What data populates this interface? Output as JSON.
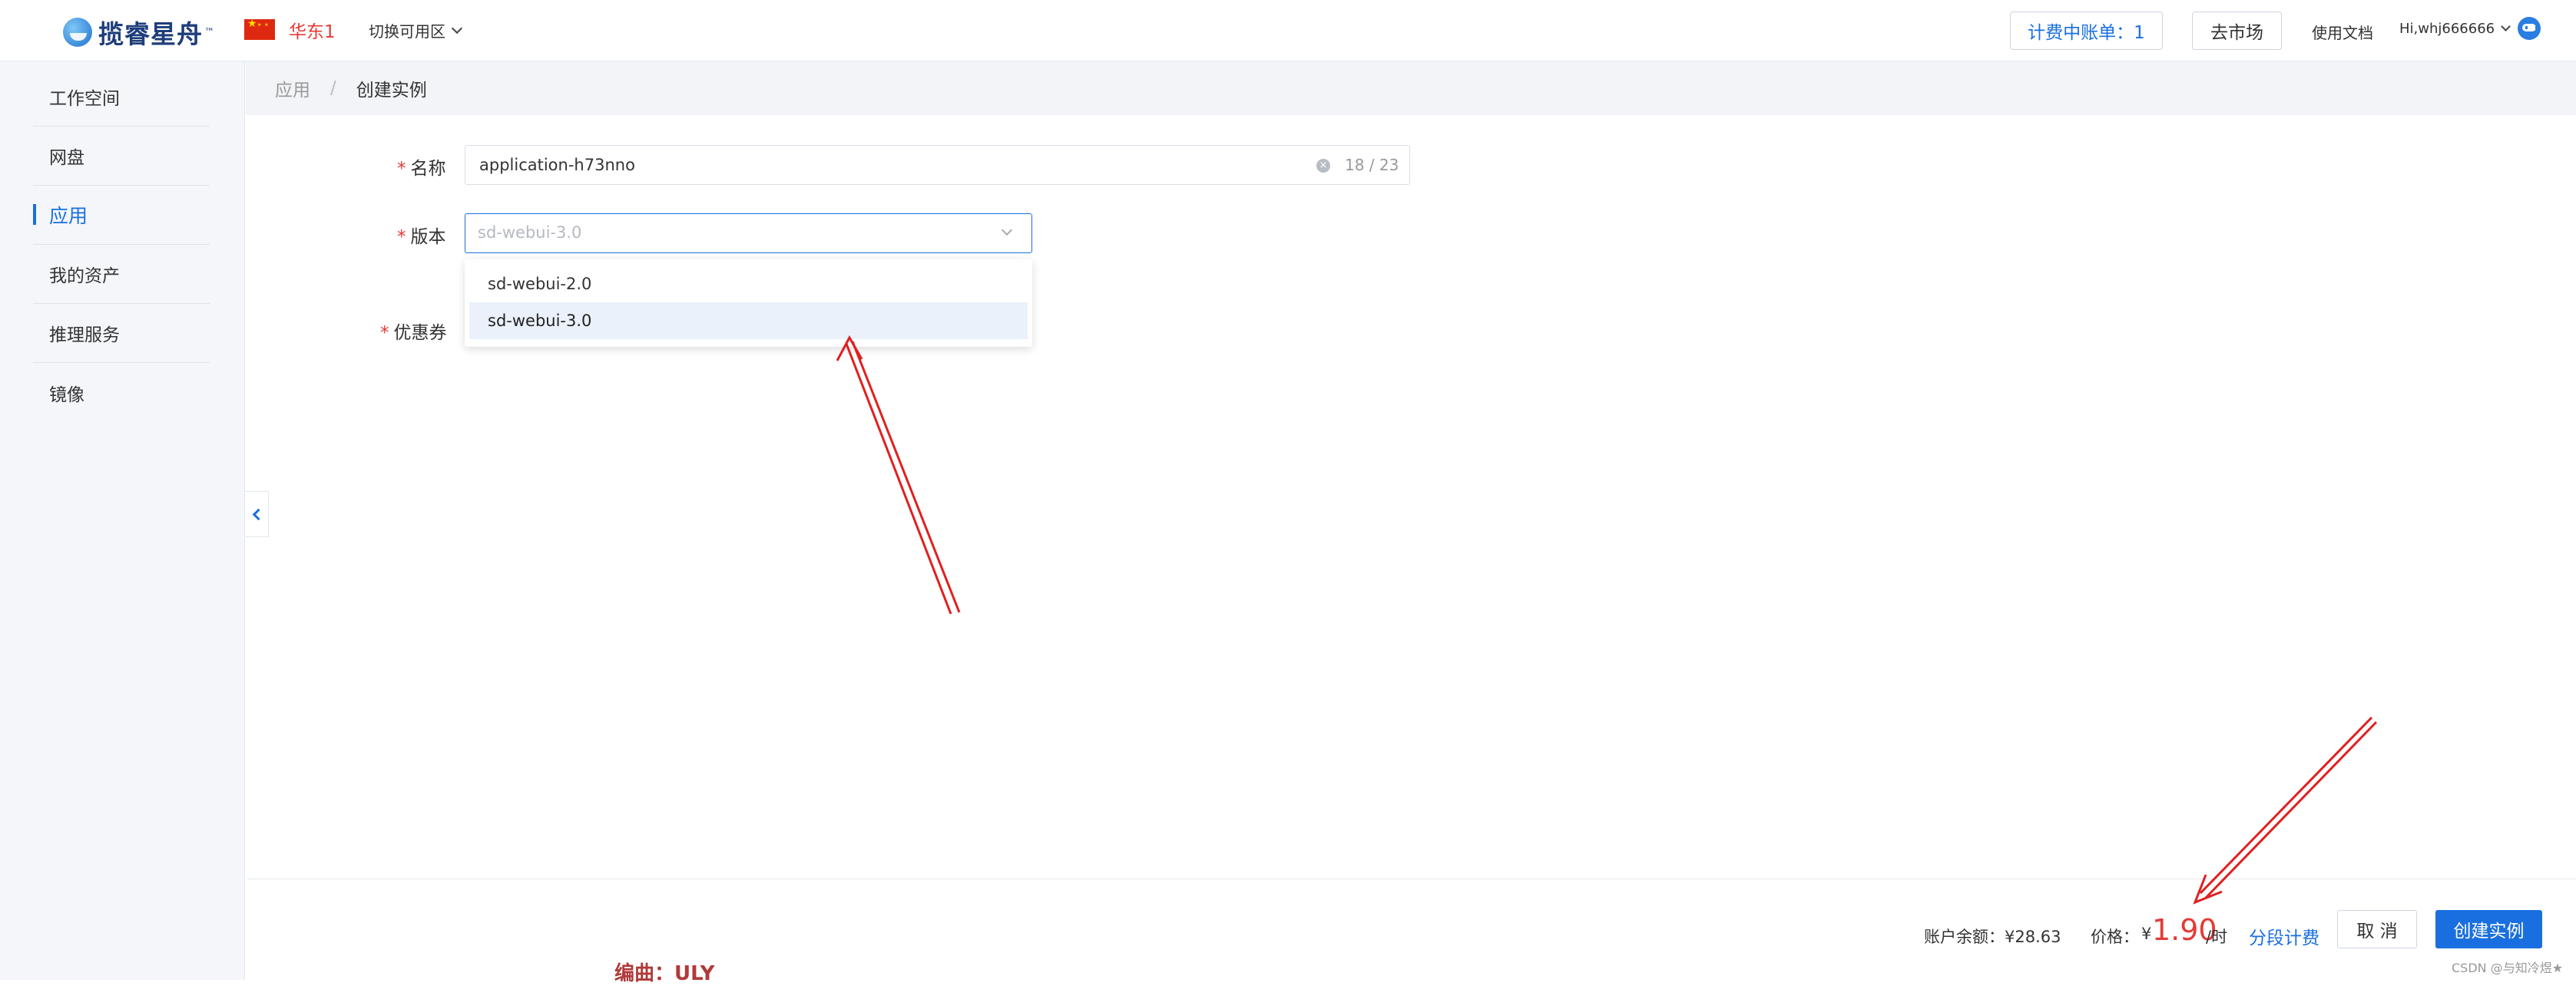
{
  "header": {
    "logo_text": "揽睿星舟",
    "logo_tm": "™",
    "region": "华东1",
    "zone_switch": "切换可用区",
    "billing_button": "计费中账单：1",
    "market_button": "去市场",
    "docs_link": "使用文档",
    "user": "Hi,whj666666"
  },
  "sidebar": {
    "items": [
      {
        "label": "工作空间",
        "active": false
      },
      {
        "label": "网盘",
        "active": false
      },
      {
        "label": "应用",
        "active": true
      },
      {
        "label": "我的资产",
        "active": false
      },
      {
        "label": "推理服务",
        "active": false
      },
      {
        "label": "镜像",
        "active": false
      }
    ]
  },
  "breadcrumb": {
    "parent": "应用",
    "separator": "/",
    "current": "创建实例"
  },
  "form": {
    "name_label": "名称",
    "name_value": "application-h73nno",
    "name_counter": "18 / 23",
    "version_label": "版本",
    "version_placeholder": "sd-webui-3.0",
    "version_options": [
      "sd-webui-2.0",
      "sd-webui-3.0"
    ],
    "version_selected": "sd-webui-3.0",
    "coupon_label": "优惠券",
    "required_mark": "*"
  },
  "footer": {
    "balance": "账户余额：¥28.63",
    "price_label": "价格：",
    "price_currency": "¥",
    "price_value": "1.90",
    "price_unit": "/时",
    "tiered_link": "分段计费",
    "cancel_button": "取 消",
    "create_button": "创建实例"
  },
  "watermarks": {
    "editor": "编曲：ULY",
    "csdn": "CSDN @与知冷煜★"
  },
  "colors": {
    "accent": "#1a6fe0",
    "danger": "#e53935",
    "annotation": "#e02020"
  },
  "icons": [
    "logo-icon",
    "china-flag-icon",
    "chevron-down-icon",
    "clear-icon",
    "chevron-left-icon",
    "robot-assistant-icon"
  ]
}
